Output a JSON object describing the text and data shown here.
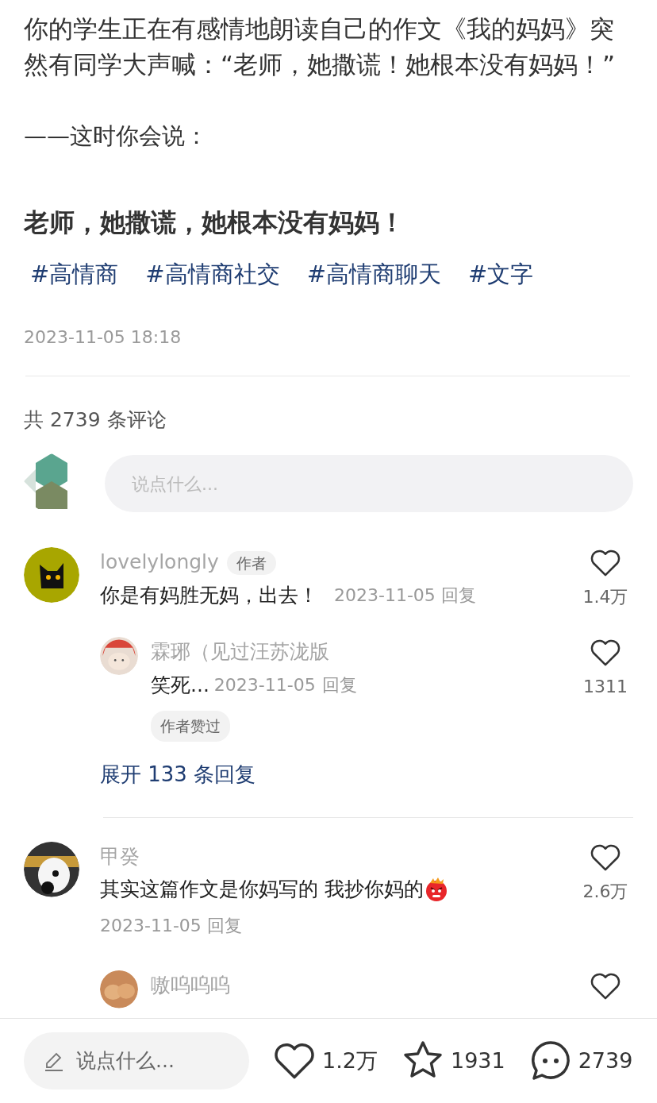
{
  "post": {
    "body": "你的学生正在有感情地朗读自己的作文《我的妈妈》突然有同学大声喊：“老师，她撒谎！她根本没有妈妈！”",
    "prompt": "——这时你会说：",
    "answer": "老师，她撒谎，她根本没有妈妈！",
    "tags": [
      "#高情商",
      "#高情商社交",
      "#高情商聊天",
      "#文字"
    ],
    "date": "2023-11-05 18:18"
  },
  "comment_count": "共 2739 条评论",
  "comment_input": {
    "placeholder": "说点什么..."
  },
  "comments": [
    {
      "author": "lovelylongly",
      "badge": "作者",
      "text": "你是有妈胜无妈，出去！",
      "date": "2023-11-05",
      "reply": "回复",
      "likes": "1.4万",
      "replies": [
        {
          "author": "霖琊（见过汪苏泷版",
          "text": "笑死...",
          "date": "2023-11-05",
          "reply": "回复",
          "likes": "1311",
          "tag": "作者赞过"
        }
      ],
      "expand": "展开 133 条回复"
    },
    {
      "author": "甲癸",
      "content": [
        {
          "kind": "text",
          "value": "其实这篇作文是你妈写的 我抄你妈的"
        },
        {
          "kind": "angry_emoji"
        }
      ],
      "date": "2023-11-05",
      "reply": "回复",
      "likes": "2.6万",
      "replies": [
        {
          "author": "嗷呜呜呜"
        }
      ]
    }
  ],
  "bottom_bar": {
    "placeholder": "说点什么...",
    "likes": "1.2万",
    "stars": "1931",
    "comments": "2739"
  }
}
